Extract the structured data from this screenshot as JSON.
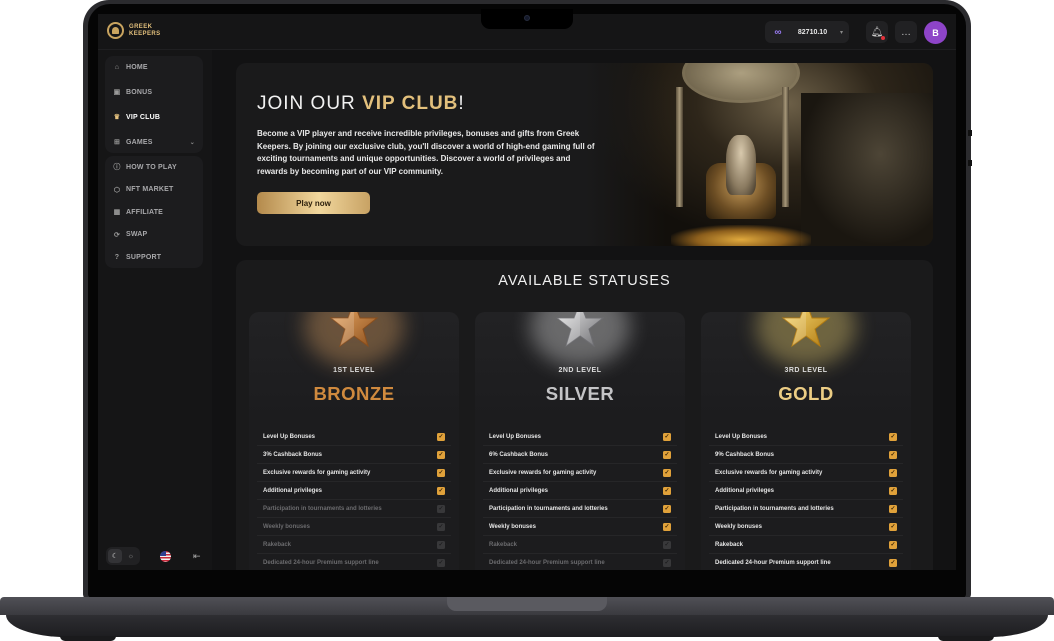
{
  "brand": {
    "name_line1": "GREEK",
    "name_line2": "KEEPERS"
  },
  "header": {
    "balance": "82710.10",
    "currency_icon": "polygon-icon"
  },
  "sidebar": {
    "group1": [
      {
        "label": "HOME",
        "icon": "home-icon"
      },
      {
        "label": "BONUS",
        "icon": "gift-icon"
      },
      {
        "label": "VIP CLUB",
        "icon": "crown-icon",
        "active": true
      },
      {
        "label": "GAMES",
        "icon": "grid-icon",
        "expandable": true
      }
    ],
    "group2": [
      {
        "label": "HOW TO PLAY",
        "icon": "info-icon"
      },
      {
        "label": "NFT MARKET",
        "icon": "cube-icon"
      },
      {
        "label": "AFFILIATE",
        "icon": "affiliate-icon"
      },
      {
        "label": "SWAP",
        "icon": "swap-icon"
      },
      {
        "label": "SUPPORT",
        "icon": "help-icon"
      }
    ]
  },
  "hero": {
    "title_prefix": "JOIN OUR ",
    "title_highlight": "VIP CLUB",
    "title_suffix": "!",
    "text": "Become a VIP player and receive incredible privileges, bonuses and gifts from Greek Keepers. By joining our exclusive club, you'll discover a world of high-end gaming full of exciting tournaments and unique opportunities. Discover a world of privileges and rewards by becoming part of our VIP community.",
    "button": "Play now"
  },
  "statuses": {
    "title": "AVAILABLE STATUSES",
    "cards": [
      {
        "level": "1ST LEVEL",
        "name": "BRONZE",
        "color": "#d08a3e",
        "star_light": "#f2b06a",
        "star_dark": "#8a4e1c",
        "perks": [
          {
            "label": "Level Up Bonuses",
            "on": true
          },
          {
            "label": "3% Cashback Bonus",
            "on": true
          },
          {
            "label": "Exclusive rewards for gaming activity",
            "on": true
          },
          {
            "label": "Additional privileges",
            "on": true
          },
          {
            "label": "Participation in tournaments and lotteries",
            "on": false
          },
          {
            "label": "Weekly bonuses",
            "on": false
          },
          {
            "label": "Rakeback",
            "on": false
          },
          {
            "label": "Dedicated 24-hour Premium support line",
            "on": false
          }
        ]
      },
      {
        "level": "2ND LEVEL",
        "name": "SILVER",
        "color": "#c4c4c6",
        "star_light": "#f0f0f0",
        "star_dark": "#6e6e72",
        "perks": [
          {
            "label": "Level Up Bonuses",
            "on": true
          },
          {
            "label": "6% Cashback Bonus",
            "on": true
          },
          {
            "label": "Exclusive rewards for gaming activity",
            "on": true
          },
          {
            "label": "Additional privileges",
            "on": true
          },
          {
            "label": "Participation in tournaments and lotteries",
            "on": true
          },
          {
            "label": "Weekly bonuses",
            "on": true
          },
          {
            "label": "Rakeback",
            "on": false
          },
          {
            "label": "Dedicated 24-hour Premium support line",
            "on": false
          }
        ]
      },
      {
        "level": "3RD LEVEL",
        "name": "GOLD",
        "color": "#eccd84",
        "star_light": "#ffe27a",
        "star_dark": "#b07a12",
        "perks": [
          {
            "label": "Level Up Bonuses",
            "on": true
          },
          {
            "label": "9% Cashback Bonus",
            "on": true
          },
          {
            "label": "Exclusive rewards for gaming activity",
            "on": true
          },
          {
            "label": "Additional privileges",
            "on": true
          },
          {
            "label": "Participation in tournaments and lotteries",
            "on": true
          },
          {
            "label": "Weekly bonuses",
            "on": true
          },
          {
            "label": "Rakeback",
            "on": true
          },
          {
            "label": "Dedicated 24-hour Premium support line",
            "on": true
          }
        ]
      }
    ]
  }
}
